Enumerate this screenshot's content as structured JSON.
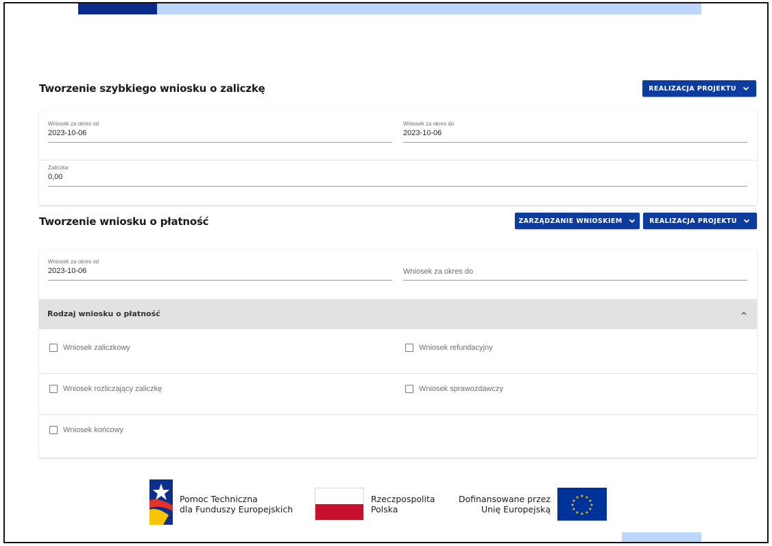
{
  "colors": {
    "primary": "#0c3d9e",
    "accent_dark": "#0b2b8a",
    "accent_light": "#bcd6fb",
    "accordion_bg": "#e2e2e2",
    "flag_red": "#c8102e",
    "eu_blue": "#003399",
    "eu_star": "#ffcc00"
  },
  "quick_advance": {
    "title": "Tworzenie szybkiego wniosku o zaliczkę",
    "button_label": "REALIZACJA PROJEKTU",
    "date_from": {
      "label": "Wniosek za okres od",
      "value": "2023-10-06"
    },
    "date_to": {
      "label": "Wniosek za okres do",
      "value": "2023-10-06"
    },
    "advance": {
      "label": "Zaliczka",
      "value": "0,00"
    }
  },
  "payment_request": {
    "title": "Tworzenie wniosku o płatność",
    "manage_button_label": "ZARZĄDZANIE WNIOSKIEM",
    "project_button_label": "REALIZACJA PROJEKTU",
    "date_from": {
      "label": "Wniosek za okres od",
      "value": "2023-10-06"
    },
    "date_to": {
      "placeholder": "Wniosek za okres do"
    },
    "type_section": {
      "title": "Rodzaj wniosku o płatność",
      "options": [
        {
          "label": "Wniosek zaliczkowy",
          "checked": false
        },
        {
          "label": "Wniosek refundacyjny",
          "checked": false
        },
        {
          "label": "Wniosek rozliczający zaliczkę",
          "checked": false
        },
        {
          "label": "Wniosek sprawozdawczy",
          "checked": false
        },
        {
          "label": "Wniosek końcowy",
          "checked": false
        }
      ]
    }
  },
  "footer": {
    "logo1_line1": "Pomoc Techniczna",
    "logo1_line2": "dla Funduszy Europejskich",
    "logo2_line1": "Rzeczpospolita",
    "logo2_line2": "Polska",
    "logo3_line1": "Dofinansowane przez",
    "logo3_line2": "Unię Europejską"
  },
  "icons": {
    "dropdown": "chevron-down-icon",
    "collapse": "chevron-up-icon",
    "checkbox": "checkbox-icon"
  }
}
